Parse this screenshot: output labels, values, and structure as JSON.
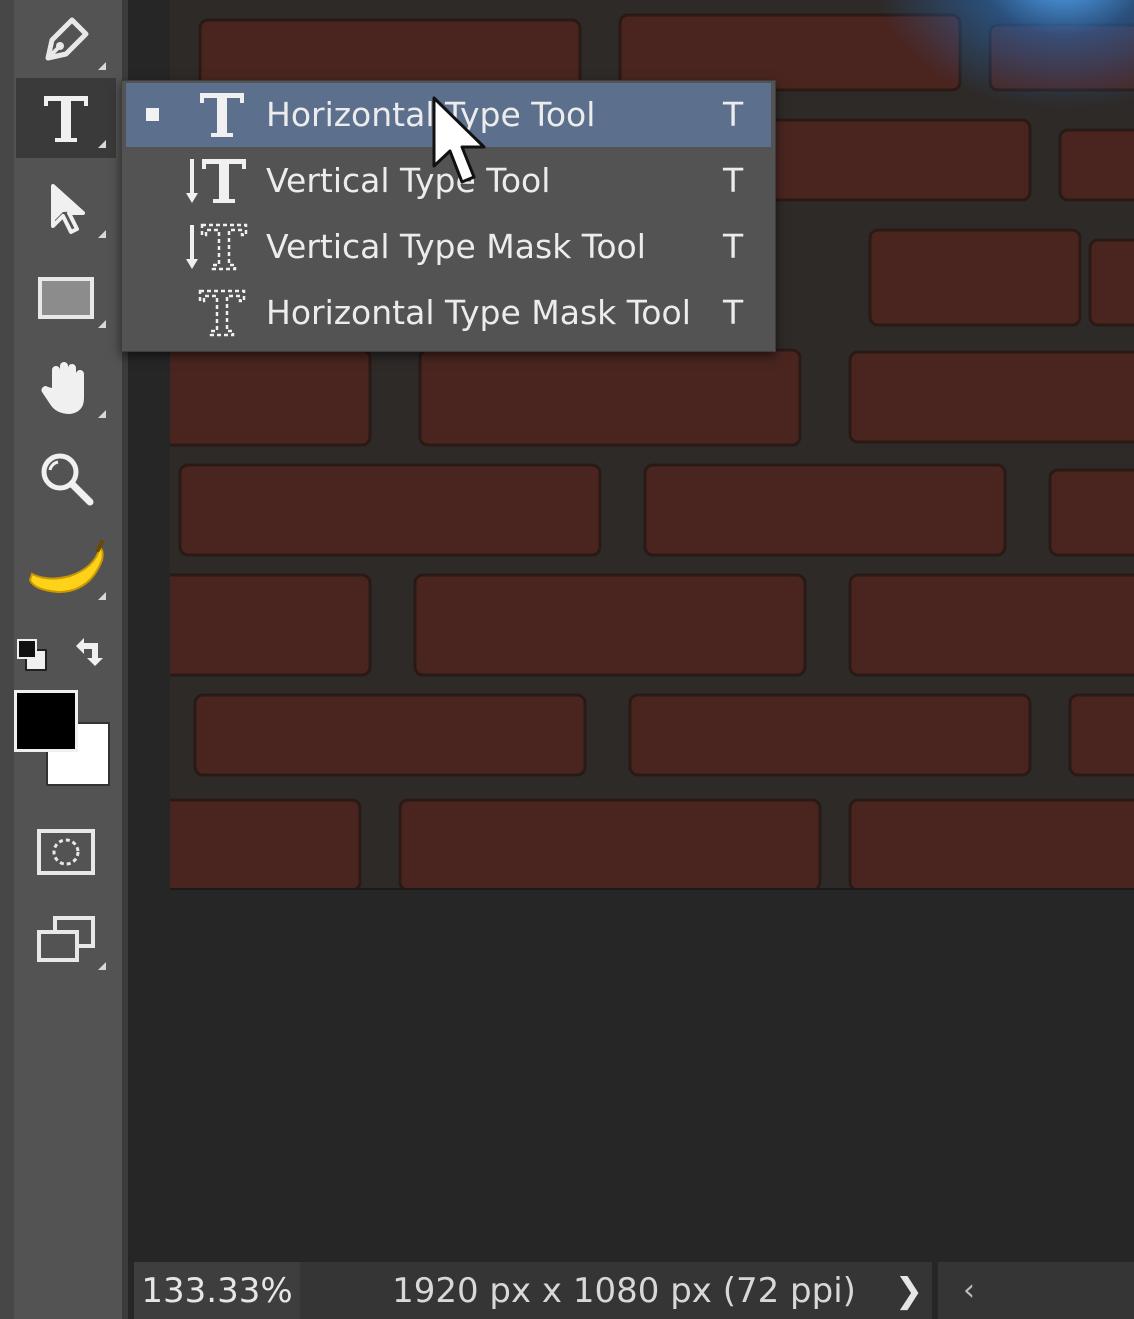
{
  "toolbar": {
    "tools": [
      {
        "name": "pen-tool",
        "icon": "pen-icon"
      },
      {
        "name": "type-tool",
        "icon": "type-icon",
        "active": true
      },
      {
        "name": "path-selection-tool",
        "icon": "arrow-icon"
      },
      {
        "name": "rectangle-tool",
        "icon": "rectangle-icon"
      },
      {
        "name": "hand-tool",
        "icon": "hand-icon"
      },
      {
        "name": "zoom-tool",
        "icon": "magnifier-icon"
      },
      {
        "name": "extra-tools",
        "icon": "banana-icon"
      }
    ],
    "foreground_color": "#000000",
    "background_color": "#ffffff"
  },
  "flyout": {
    "items": [
      {
        "label": "Horizontal Type Tool",
        "shortcut": "T",
        "selected": true,
        "icon": "horizontal-type-icon"
      },
      {
        "label": "Vertical Type Tool",
        "shortcut": "T",
        "selected": false,
        "icon": "vertical-type-icon"
      },
      {
        "label": "Vertical Type Mask Tool",
        "shortcut": "T",
        "selected": false,
        "icon": "vertical-type-mask-icon"
      },
      {
        "label": "Horizontal Type Mask Tool",
        "shortcut": "T",
        "selected": false,
        "icon": "horizontal-type-mask-icon"
      }
    ]
  },
  "status": {
    "zoom": "133.33%",
    "doc_info": "1920 px x 1080 px (72 ppi)",
    "next_label": "❯",
    "prev_label": "‹"
  },
  "colors": {
    "toolbar_bg": "#535353",
    "menu_highlight": "#5c6f8c",
    "canvas_bg": "#262626",
    "brick": "#5a2a22"
  }
}
